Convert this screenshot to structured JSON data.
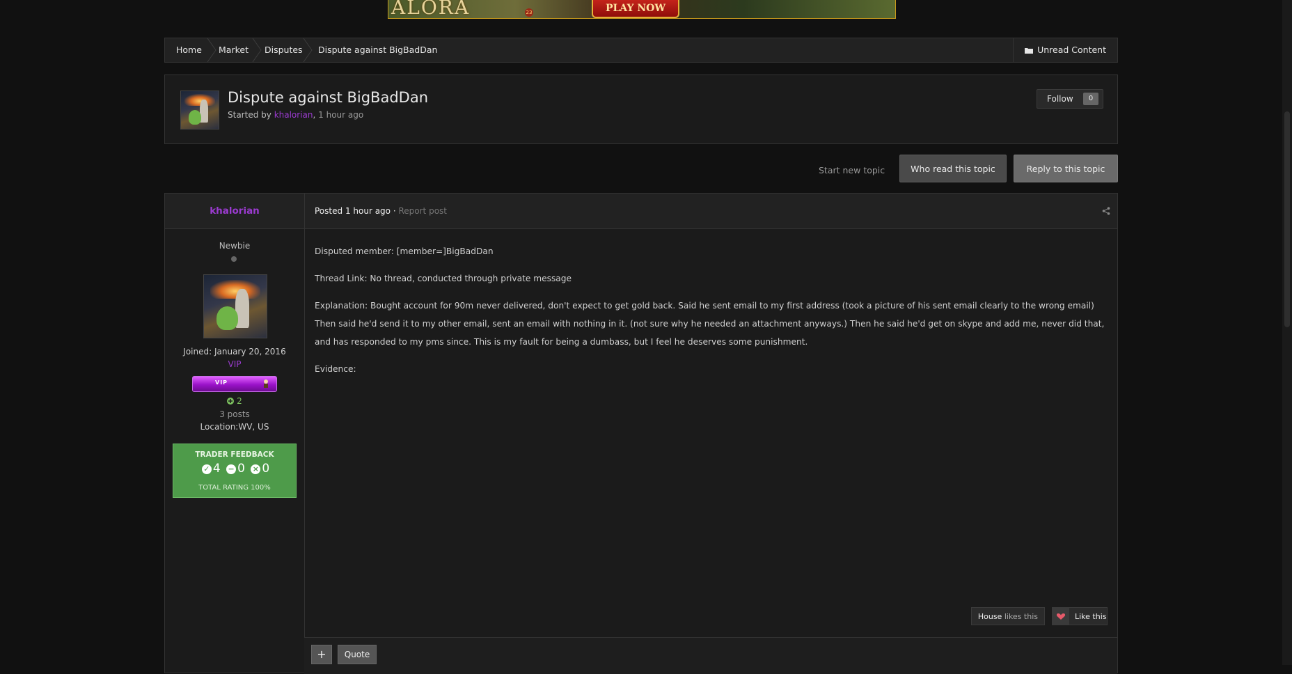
{
  "banner": {
    "logo_text": "ALORA",
    "play_label": "PLAY NOW",
    "badge": "23"
  },
  "breadcrumb": {
    "items": [
      "Home",
      "Market",
      "Disputes",
      "Dispute against BigBadDan"
    ],
    "unread_label": "Unread Content"
  },
  "topic": {
    "title": "Dispute against BigBadDan",
    "started_by_prefix": "Started by",
    "author": "khalorian",
    "time": "1 hour ago",
    "follow_label": "Follow",
    "follow_count": "0"
  },
  "actions": {
    "start_new_topic": "Start new topic",
    "who_read": "Who read this topic",
    "reply": "Reply to this topic"
  },
  "post": {
    "author": "khalorian",
    "posted_prefix": "Posted",
    "posted_time": "1 hour ago",
    "separator": "·",
    "report_label": "Report post",
    "rank": "Newbie",
    "joined": "Joined: January 20, 2016",
    "group": "VIP",
    "vip_bar_text": "VIP",
    "reputation": "2",
    "posts_count": "3 posts",
    "location": "Location:WV, US",
    "feedback": {
      "title": "TRADER FEEDBACK",
      "positive": "4",
      "neutral": "0",
      "negative": "0",
      "total": "TOTAL RATING 100%"
    },
    "body": [
      "Disputed member: [member=]BigBadDan",
      "Thread Link: No thread, conducted through private message",
      "Explanation: Bought account for 90m never delivered, don't expect to get gold back. Said he sent email to my first address (took a picture of his sent email clearly to the wrong email) Then said he'd send it to my other email, sent  an email with nothing in it. (not sure why he needed an attachment anyways.) Then he said he'd get on skype and add me, never did that, and has responded to my pms since. This is my fault for being a dumbass, but I feel he deserves some punishment.",
      "Evidence:"
    ],
    "likes": {
      "name": "House",
      "suffix": "likes this",
      "like_label": "Like this"
    },
    "quote_label": "Quote",
    "plus_label": "+"
  },
  "colors": {
    "author": "#9b3bd0",
    "feedback_bg": "#4e9b4a",
    "vip": "#9a12c9"
  }
}
